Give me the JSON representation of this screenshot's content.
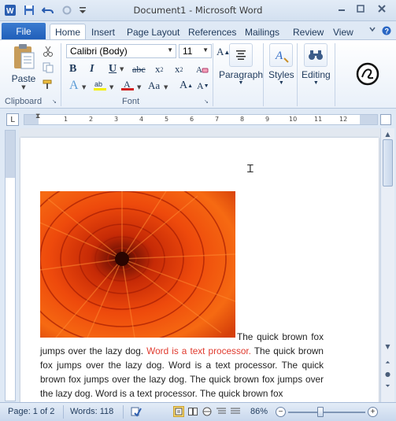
{
  "window": {
    "title": "Document1 - Microsoft Word"
  },
  "qat": {
    "icons": [
      "word-app-icon",
      "save-icon",
      "undo-icon",
      "redo-icon",
      "customize-qat-icon"
    ]
  },
  "tabs": [
    {
      "label": "File"
    },
    {
      "label": "Home"
    },
    {
      "label": "Insert"
    },
    {
      "label": "Page Layout"
    },
    {
      "label": "References"
    },
    {
      "label": "Mailings"
    },
    {
      "label": "Review"
    },
    {
      "label": "View"
    }
  ],
  "ribbon": {
    "clipboard": {
      "paste_label": "Paste",
      "group_label": "Clipboard"
    },
    "font": {
      "name": "Calibri (Body)",
      "size": "11",
      "group_label": "Font"
    },
    "paragraph_label": "Paragraph",
    "styles_label": "Styles",
    "editing_label": "Editing"
  },
  "ruler": {
    "numbers": [
      "1",
      "2",
      "3",
      "4",
      "5",
      "6",
      "7",
      "8",
      "9",
      "10",
      "11",
      "12"
    ]
  },
  "document": {
    "text_1": "The quick brown fox jumps over the lazy dog. ",
    "text_red": "Word is a text processor.",
    "text_2": " The quick brown fox jumps over the lazy dog.  Word is a text processor.  The quick brown fox jumps over the lazy dog.  The quick brown fox jumps over the lazy dog. Word is a text processor. The quick brown fox"
  },
  "status": {
    "page": "Page: 1 of 2",
    "words": "Words: 118",
    "zoom": "86%",
    "zoom_level_percent": 86
  },
  "colors": {
    "file_tab": "#2a67c4",
    "red_text": "#e03a2e",
    "ribbon_bg": "#dfe9f5"
  }
}
